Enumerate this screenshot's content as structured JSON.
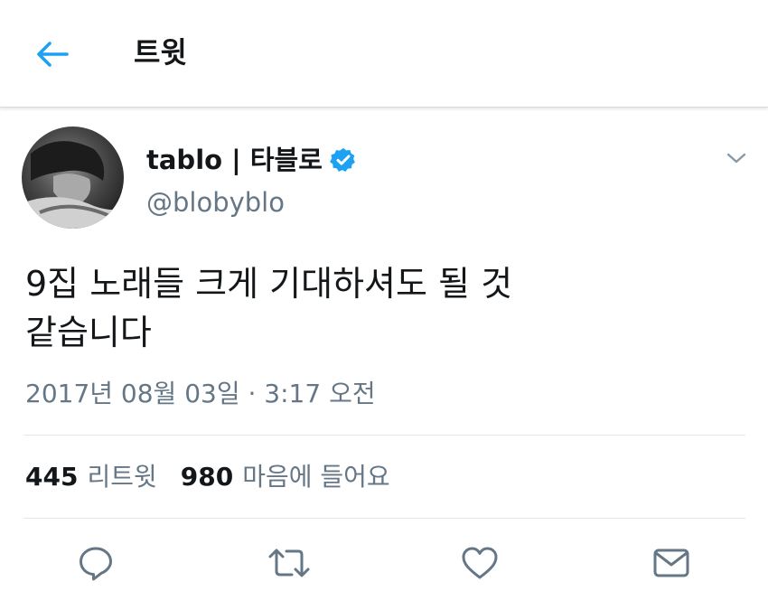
{
  "header": {
    "title": "트윗",
    "back_icon": "arrow-left-icon",
    "accent_color": "#1da1f2"
  },
  "tweet": {
    "author": {
      "display_name": "tablo | 타블로",
      "verified": true,
      "handle": "@blobyblo"
    },
    "text": "9집 노래들 크게 기대하셔도 될 것\n같습니다",
    "timestamp": "2017년 08월 03일 · 3:17 오전",
    "stats": {
      "retweets_count": "445",
      "retweets_label": "리트윗",
      "likes_count": "980",
      "likes_label": "마음에 들어요"
    }
  },
  "actions": [
    {
      "icon": "reply-icon"
    },
    {
      "icon": "retweet-icon"
    },
    {
      "icon": "heart-icon"
    },
    {
      "icon": "mail-icon"
    }
  ],
  "colors": {
    "text_primary": "#14171a",
    "text_secondary": "#657786",
    "verified_blue": "#1da1f2",
    "icon_gray": "#657786",
    "divider": "#e1e8ed"
  }
}
